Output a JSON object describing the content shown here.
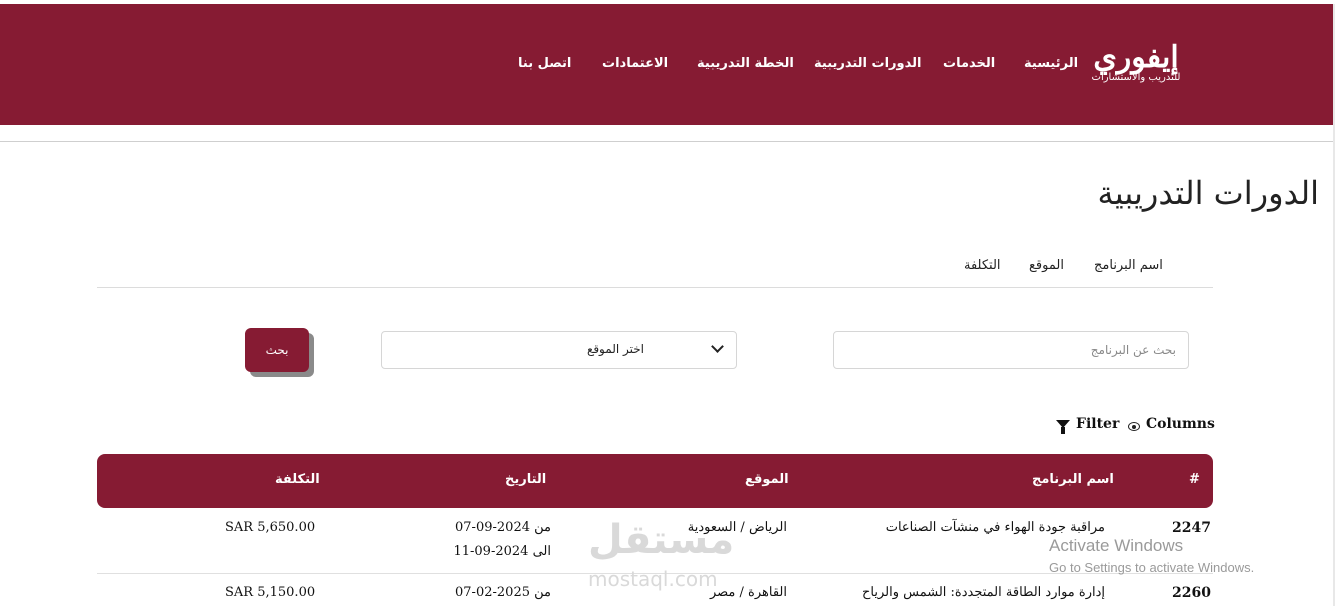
{
  "brand": {
    "logo_main": "إيفوري",
    "logo_sub": "للتدريب والاستشارات"
  },
  "nav": {
    "items": [
      "الرئيسية",
      "الخدمات",
      "الدورات التدريبية",
      "الخطة التدريبية",
      "الاعتمادات",
      "اتصل بنا"
    ]
  },
  "page": {
    "title": "الدورات التدريبية"
  },
  "filter_tabs": [
    "اسم البرنامج",
    "الموقع",
    "التكلفة"
  ],
  "search": {
    "placeholder": "بحث عن البرنامج",
    "location_select": "اختر الموقع",
    "button": "بحث"
  },
  "toolbar": {
    "filter": "Filter",
    "columns": "Columns"
  },
  "table": {
    "headers": [
      "#",
      "اسم البرنامج",
      "الموقع",
      "التاريخ",
      "التكلفة"
    ],
    "rows": [
      {
        "id": "2247",
        "name": "مراقبة جودة الهواء في منشآت الصناعات",
        "location": "الرياض / السعودية",
        "date_from": "من 2024-09-07",
        "date_to": "الى 2024-09-11",
        "cost": "SAR 5,650.00"
      },
      {
        "id": "2260",
        "name": "إدارة موارد الطاقة المتجددة: الشمس والرياح",
        "location": "القاهرة / مصر",
        "date_from": "من 2025-02-07",
        "date_to": "",
        "cost": "SAR 5,150.00"
      }
    ]
  },
  "overlays": {
    "watermark": "مستقل",
    "watermark_sub": "mostaql.com",
    "activate_title": "Activate Windows",
    "activate_sub": "Go to Settings to activate Windows."
  },
  "colors": {
    "brand": "#861b33",
    "shadow": "#8a8a8a"
  }
}
